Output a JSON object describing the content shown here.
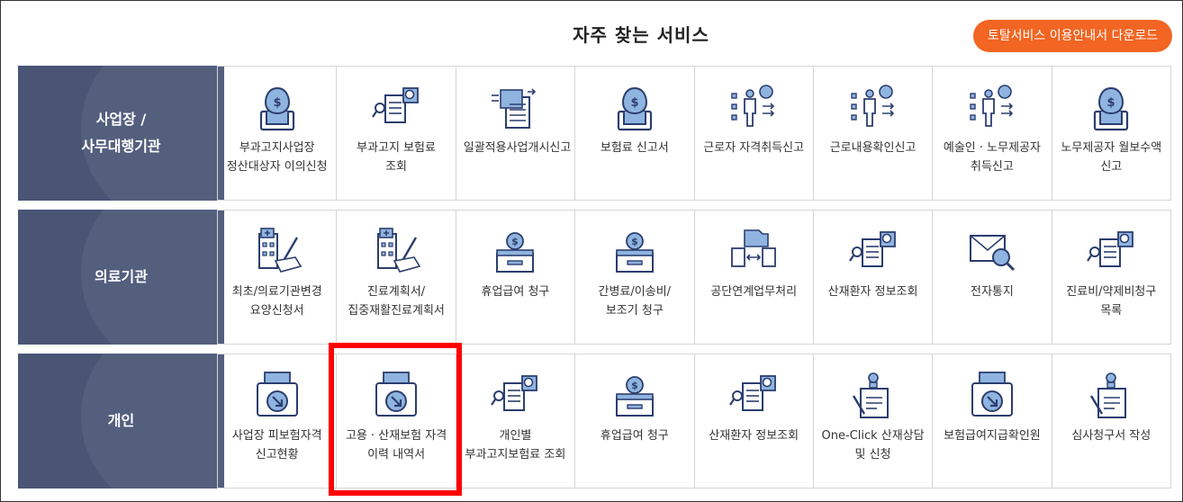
{
  "page": {
    "title": "자주 찾는 서비스",
    "download_button": "토탈서비스 이용안내서 다운로드"
  },
  "categories": [
    {
      "name": "사업장 /\n사무대행기관",
      "tiles": [
        {
          "label": "부과고지사업장 정산대상자 이의신청",
          "icon": "money-bag-monitor-icon"
        },
        {
          "label": "부과고지 보험료 조회",
          "icon": "document-search-icon"
        },
        {
          "label": "일괄적용사업개시신고",
          "icon": "document-list-icon"
        },
        {
          "label": "보험료 신고서",
          "icon": "money-bag-monitor-icon"
        },
        {
          "label": "근로자 자격취득신고",
          "icon": "worker-list-icon"
        },
        {
          "label": "근로내용확인신고",
          "icon": "worker-list-icon"
        },
        {
          "label": "예술인 · 노무제공자 취득신고",
          "icon": "worker-list-icon"
        },
        {
          "label": "노무제공자 월보수액 신고",
          "icon": "money-bag-monitor-icon"
        }
      ]
    },
    {
      "name": "의료기관",
      "tiles": [
        {
          "label": "최초/의료기관변경 요양신청서",
          "icon": "hospital-document-icon"
        },
        {
          "label": "진료계획서/집중재활진료계획서",
          "icon": "hospital-document-icon"
        },
        {
          "label": "휴업급여 청구",
          "icon": "coin-box-icon"
        },
        {
          "label": "간병료/이송비/보조기 청구",
          "icon": "coin-box-icon"
        },
        {
          "label": "공단연계업무처리",
          "icon": "folder-exchange-icon"
        },
        {
          "label": "산재환자 정보조회",
          "icon": "document-search-icon"
        },
        {
          "label": "전자통지",
          "icon": "mail-search-icon"
        },
        {
          "label": "진료비/약제비청구 목록",
          "icon": "document-search-icon"
        }
      ]
    },
    {
      "name": "개인",
      "tiles": [
        {
          "label": "사업장 피보험자격 신고현황",
          "icon": "printer-download-icon"
        },
        {
          "label": "고용 · 산재보험 자격 이력 내역서",
          "icon": "printer-download-icon"
        },
        {
          "label": "개인별 부과고지보험료 조회",
          "icon": "document-search-icon"
        },
        {
          "label": "휴업급여 청구",
          "icon": "coin-box-icon"
        },
        {
          "label": "산재환자 정보조회",
          "icon": "document-search-icon"
        },
        {
          "label": "One-Click 산재상담 및 신청",
          "icon": "pen-document-icon"
        },
        {
          "label": "보험급여지급확인원",
          "icon": "printer-download-icon"
        },
        {
          "label": "심사청구서 작성",
          "icon": "pen-document-icon"
        }
      ]
    }
  ],
  "colors": {
    "category_bg": "#4a5576",
    "button_bg": "#f26522",
    "icon_stroke": "#2c3e6e",
    "icon_fill": "#8fb4e0",
    "highlight": "#ff0000"
  }
}
